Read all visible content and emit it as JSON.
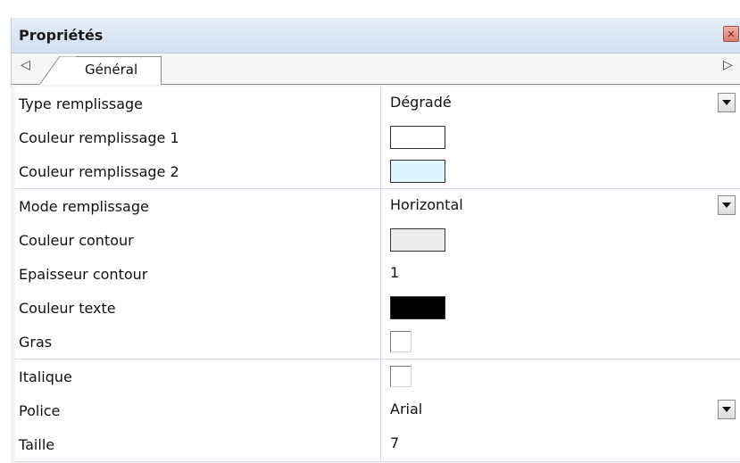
{
  "panel": {
    "title": "Propriétés",
    "close_icon": "close-icon"
  },
  "tabs": {
    "left_arrow": "◁",
    "right_arrow": "▷",
    "active_label": "Général"
  },
  "properties": [
    {
      "name": "Type remplissage",
      "kind": "dropdown",
      "value": "Dégradé"
    },
    {
      "name": "Couleur remplissage 1",
      "kind": "color",
      "color": "#ffffff"
    },
    {
      "name": "Couleur remplissage 2",
      "kind": "color",
      "color": "#dff4ff"
    },
    {
      "name": "Mode remplissage",
      "kind": "dropdown",
      "value": "Horizontal"
    },
    {
      "name": "Couleur contour",
      "kind": "color",
      "color": "#ececec"
    },
    {
      "name": "Epaisseur contour",
      "kind": "text",
      "value": "1"
    },
    {
      "name": "Couleur texte",
      "kind": "color",
      "color": "#000000"
    },
    {
      "name": "Gras",
      "kind": "checkbox",
      "checked": false
    },
    {
      "name": "Italique",
      "kind": "checkbox",
      "checked": false
    },
    {
      "name": "Police",
      "kind": "dropdown",
      "value": "Arial"
    },
    {
      "name": "Taille",
      "kind": "text",
      "value": "7"
    }
  ]
}
